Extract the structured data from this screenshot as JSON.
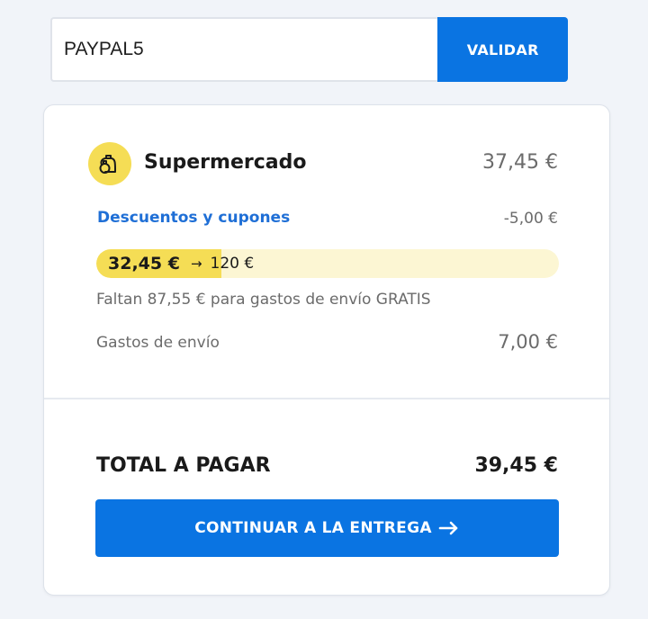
{
  "coupon": {
    "value": "PAYPAL5",
    "button_label": "VALIDAR"
  },
  "store": {
    "icon": "grocery-bottles-icon",
    "name": "Supermercado",
    "price": "37,45 €"
  },
  "discounts": {
    "label": "Descuentos y cupones",
    "amount": "-5,00 €"
  },
  "free_shipping_progress": {
    "current": "32,45 €",
    "goal": "120 €",
    "fraction": 0.27,
    "note": "Faltan 87,55 € para gastos de envío GRATIS"
  },
  "shipping": {
    "label": "Gastos de envío",
    "cost": "7,00 €"
  },
  "total": {
    "label": "TOTAL A PAGAR",
    "amount": "39,45 €"
  },
  "continue_button": {
    "label": "CONTINUAR A LA ENTREGA",
    "icon": "arrow-right-icon"
  },
  "colors": {
    "accent": "#0a74e2",
    "link": "#1f6fd6",
    "progress_fill": "#f5dd55",
    "progress_track": "#fcf6d3",
    "icon_background": "#f5dd55",
    "page_background": "#f1f4f9"
  }
}
